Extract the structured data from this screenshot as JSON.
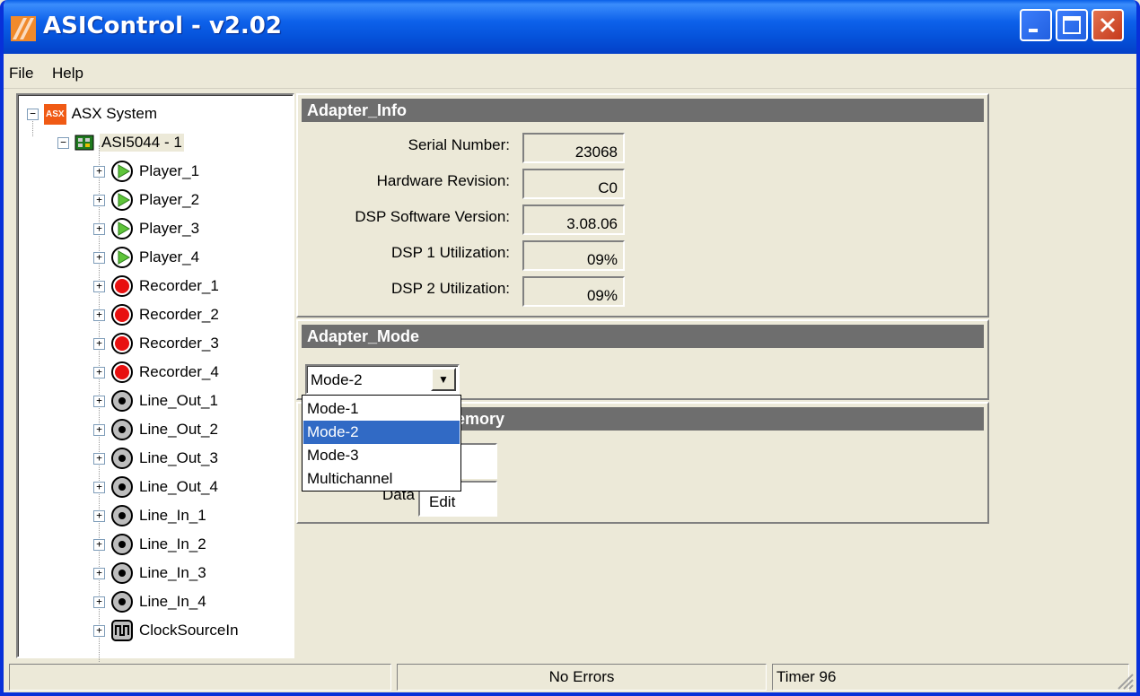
{
  "window": {
    "title": "ASIControl - v2.02",
    "controls": {
      "minimize": "minimize",
      "maximize": "maximize",
      "close": "close"
    },
    "colors": {
      "titlebar": "#0552da",
      "close": "#c5391c",
      "selection": "#316ac5",
      "panel_header": "#6e6e6e"
    }
  },
  "menubar": {
    "items": [
      {
        "label": "File"
      },
      {
        "label": "Help"
      }
    ]
  },
  "tree": {
    "root": {
      "badge": "ASX",
      "label": "ASX System",
      "expander": "−"
    },
    "adapter": {
      "label": "ASI5044 - 1",
      "expander": "−"
    },
    "nodes": [
      {
        "label": "Player_1",
        "icon": "play-icon",
        "expander": "+"
      },
      {
        "label": "Player_2",
        "icon": "play-icon",
        "expander": "+"
      },
      {
        "label": "Player_3",
        "icon": "play-icon",
        "expander": "+"
      },
      {
        "label": "Player_4",
        "icon": "play-icon",
        "expander": "+"
      },
      {
        "label": "Recorder_1",
        "icon": "record-icon",
        "expander": "+"
      },
      {
        "label": "Recorder_2",
        "icon": "record-icon",
        "expander": "+"
      },
      {
        "label": "Recorder_3",
        "icon": "record-icon",
        "expander": "+"
      },
      {
        "label": "Recorder_4",
        "icon": "record-icon",
        "expander": "+"
      },
      {
        "label": "Line_Out_1",
        "icon": "line-icon",
        "expander": "+"
      },
      {
        "label": "Line_Out_2",
        "icon": "line-icon",
        "expander": "+"
      },
      {
        "label": "Line_Out_3",
        "icon": "line-icon",
        "expander": "+"
      },
      {
        "label": "Line_Out_4",
        "icon": "line-icon",
        "expander": "+"
      },
      {
        "label": "Line_In_1",
        "icon": "line-icon",
        "expander": "+"
      },
      {
        "label": "Line_In_2",
        "icon": "line-icon",
        "expander": "+"
      },
      {
        "label": "Line_In_3",
        "icon": "line-icon",
        "expander": "+"
      },
      {
        "label": "Line_In_4",
        "icon": "line-icon",
        "expander": "+"
      },
      {
        "label": "ClockSourceIn",
        "icon": "clock-icon",
        "expander": "+"
      }
    ]
  },
  "adapter_info": {
    "header": "Adapter_Info",
    "rows": [
      {
        "label": "Serial Number:",
        "value": "23068"
      },
      {
        "label": "Hardware Revision:",
        "value": "C0"
      },
      {
        "label": "DSP Software Version:",
        "value": "3.08.06"
      },
      {
        "label": "DSP 1 Utilization:",
        "value": "09%"
      },
      {
        "label": "DSP 2 Utilization:",
        "value": "09%"
      }
    ]
  },
  "adapter_mode": {
    "header": "Adapter_Mode",
    "selected": "Mode-2",
    "arrow": "▼",
    "options": [
      "Mode-1",
      "Mode-2",
      "Mode-3",
      "Multichannel"
    ]
  },
  "memory": {
    "header_visible": "emory",
    "data_label": "Data",
    "edit_label": "Edit"
  },
  "statusbar": {
    "message": "No Errors",
    "timer": "Timer 96"
  }
}
